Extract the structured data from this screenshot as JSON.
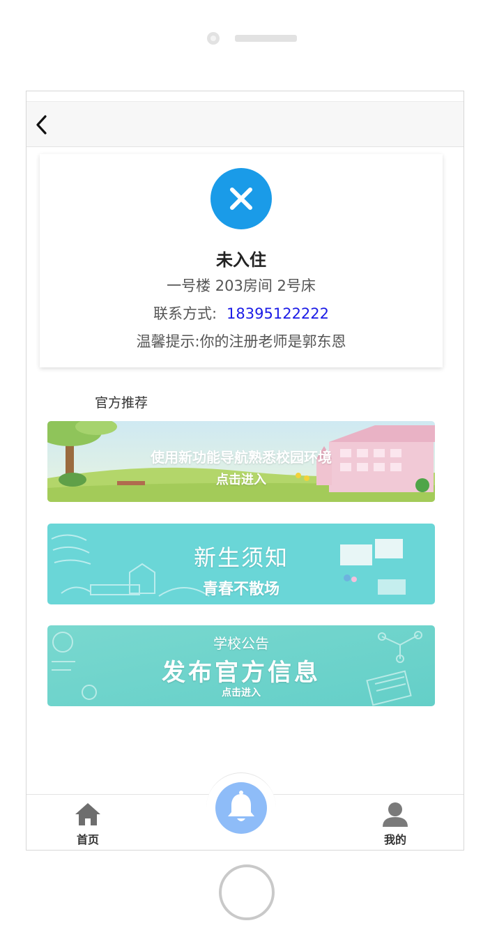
{
  "status": {
    "title": "未入住",
    "room_info": "一号楼 203房间 2号床",
    "contact_label": "联系方式:",
    "contact_phone": "18395122222",
    "tip": "温馨提示:你的注册老师是郭东恩",
    "icon": "close-icon",
    "icon_color": "#1a9be8"
  },
  "recommend": {
    "title": "官方推荐",
    "banners": [
      {
        "line1": "使用新功能导航熟悉校园环境",
        "line2": "点击进入"
      },
      {
        "line1": "新生须知",
        "line2": "青春不散场"
      },
      {
        "line1": "学校公告",
        "line2": "发布官方信息",
        "line3": "点击进入"
      }
    ]
  },
  "tabbar": {
    "home_label": "首页",
    "mine_label": "我的",
    "center_icon": "bell-icon",
    "center_color": "#8ebcf8"
  },
  "colors": {
    "phone_link": "#1b1be6",
    "banner_teal": "#6cd6d6",
    "banner_grass": "#b7d96c"
  }
}
